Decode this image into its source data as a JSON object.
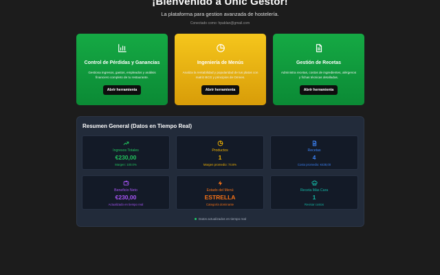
{
  "header": {
    "title": "¡Bienvenido a Unic Gestor!",
    "subtitle": "La plataforma para gestion avanzada de hostelería.",
    "connected": "Conectado como: hpablan@gmail.com"
  },
  "tools": [
    {
      "title": "Control de Pérdidas y Ganancias",
      "description": "Gestiona ingresos, gastos, empleados y análisis financiero completo de tu restaurante.",
      "button": "Abrir herramienta",
      "icon": "bar-chart-icon",
      "color": "#15a944"
    },
    {
      "title": "Ingeniería de Menús",
      "description": "Analiza la rentabilidad y popularidad de tus platos con matriz BCG y principios de Omnes.",
      "button": "Abrir herramienta",
      "icon": "pie-chart-icon",
      "color": "#f5c61c"
    },
    {
      "title": "Gestión de Recetas",
      "description": "Administra recetas, costos de ingredientes, alérgenos y fichas técnicas detalladas.",
      "button": "Abrir herramienta",
      "icon": "document-icon",
      "color": "#15a944"
    }
  ],
  "summary": {
    "title": "Resumen General (Datos en Tiempo Real)",
    "cards": [
      {
        "label": "Ingresos Totales",
        "value": "€230,00",
        "foot": "Margen: 100.0%",
        "icon": "trending-up-icon",
        "color": "#22c55e"
      },
      {
        "label": "Productos",
        "value": "1",
        "foot": "Margen promedio: 74.6%",
        "icon": "pie-chart-icon",
        "color": "#f5b400"
      },
      {
        "label": "Recetas",
        "value": "4",
        "foot": "Costo promedio: €438,00",
        "icon": "document-icon",
        "color": "#3b82f6"
      },
      {
        "label": "Beneficio Neto",
        "value": "€230,00",
        "foot": "Actualizado en tiempo real",
        "icon": "wallet-icon",
        "color": "#a855f7"
      },
      {
        "label": "Estado del Menú",
        "value": "ESTRELLA",
        "foot": "Categoría dominante",
        "icon": "lightning-icon",
        "color": "#f97316"
      },
      {
        "label": "Receta Más Cara",
        "value": "1",
        "foot": "Revisar costos",
        "icon": "chef-hat-icon",
        "color": "#14b8a6"
      }
    ],
    "footer": "Datos actualizados en tiempo real"
  }
}
